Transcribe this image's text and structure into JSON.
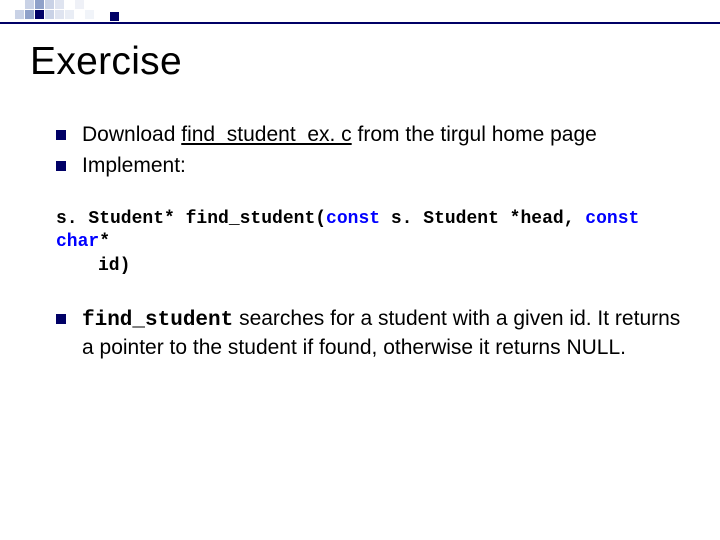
{
  "title": "Exercise",
  "bullets": {
    "b1_pre": "Download ",
    "b1_link": "find_student_ex. c",
    "b1_post": " from the tirgul home page",
    "b2": "Implement:",
    "b3_code": "find_student",
    "b3_rest": " searches for a student with a given id. It returns a pointer to the student if found, otherwise it returns NULL."
  },
  "code": {
    "l1a": "s. Student* find_student(",
    "kw1": "const",
    "l1b": " s. Student *head, ",
    "kw2": "const",
    "l1c": " ",
    "kw3": "char",
    "l1d": "*",
    "l2": "id)"
  },
  "decor": {
    "navy": "#000066",
    "light": "#c9d2e6",
    "mid": "#8fa1c9"
  }
}
